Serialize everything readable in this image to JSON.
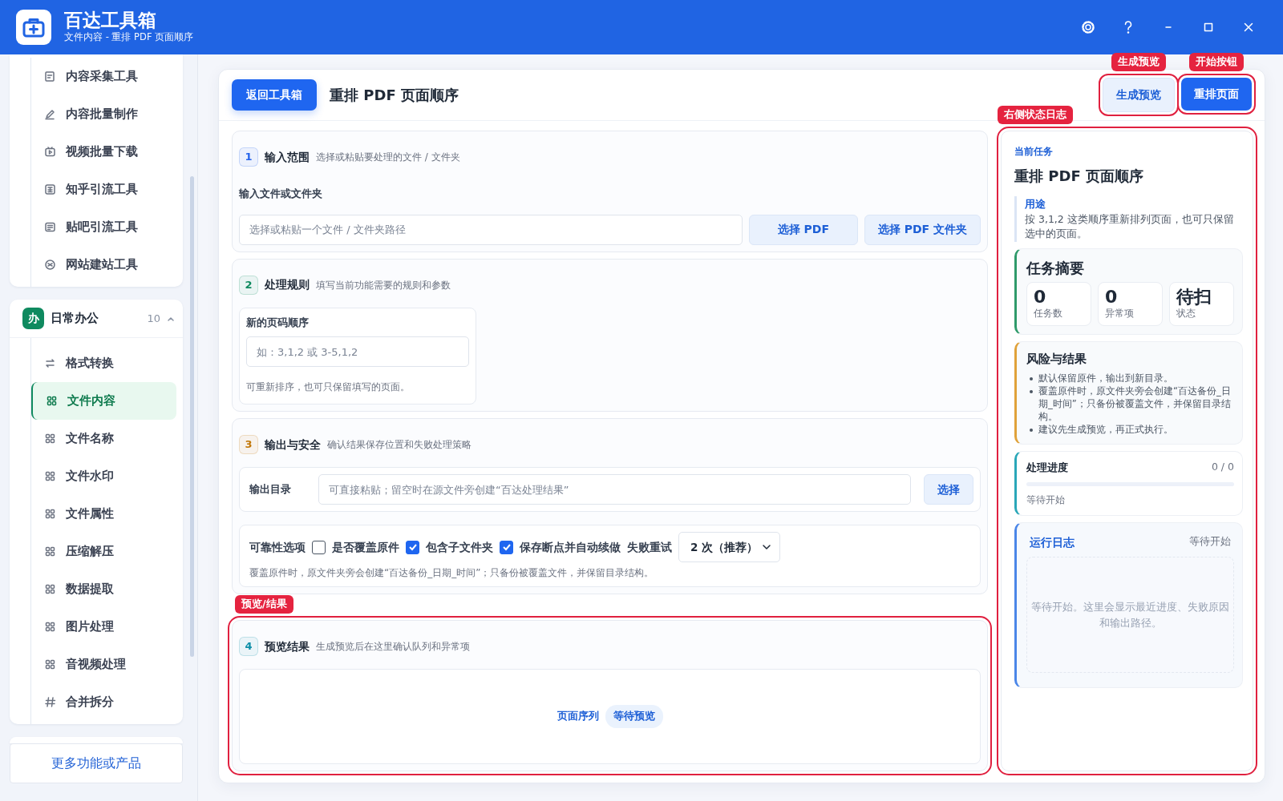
{
  "app": {
    "title": "百达工具箱",
    "subtitle": "文件内容 - 重排 PDF 页面顺序"
  },
  "sidebar": {
    "groups": [
      {
        "items": [
          {
            "label": "内容采集工具",
            "selected": false
          },
          {
            "label": "内容批量制作",
            "selected": false
          },
          {
            "label": "视频批量下载",
            "selected": false
          },
          {
            "label": "知乎引流工具",
            "selected": false
          },
          {
            "label": "贴吧引流工具",
            "selected": false
          },
          {
            "label": "网站建站工具",
            "selected": false
          }
        ]
      },
      {
        "badge": "办",
        "title": "日常办公",
        "count": "10",
        "expanded": true,
        "items": [
          {
            "label": "格式转换",
            "selected": false
          },
          {
            "label": "文件内容",
            "selected": true
          },
          {
            "label": "文件名称",
            "selected": false
          },
          {
            "label": "文件水印",
            "selected": false
          },
          {
            "label": "文件属性",
            "selected": false
          },
          {
            "label": "压缩解压",
            "selected": false
          },
          {
            "label": "数据提取",
            "selected": false
          },
          {
            "label": "图片处理",
            "selected": false
          },
          {
            "label": "音视频处理",
            "selected": false
          },
          {
            "label": "合并拆分",
            "selected": false
          }
        ]
      }
    ],
    "more_button": "更多功能或产品"
  },
  "toolbar": {
    "back_button": "返回工具箱",
    "title": "重排 PDF 页面顺序",
    "preview_annotation": "生成预览",
    "preview_button": "生成预览",
    "start_annotation": "开始按钮",
    "start_button": "重排页面"
  },
  "sections": [
    {
      "kind": "input",
      "number": "1",
      "color": "#2563eb",
      "title": "输入范围",
      "hint": "选择或粘贴要处理的文件 / 文件夹",
      "field_label": "输入文件或文件夹",
      "placeholder": "选择或粘贴一个文件 / 文件夹路径",
      "buttons": [
        "选择 PDF",
        "选择 PDF 文件夹"
      ]
    },
    {
      "kind": "rules",
      "number": "2",
      "color": "#0f8a5f",
      "title": "处理规则",
      "hint": "填写当前功能需要的规则和参数",
      "field_label": "新的页码顺序",
      "placeholder": "如：3,1,2 或 3-5,1,2",
      "help": "可重新排序，也可只保留填写的页面。"
    },
    {
      "kind": "output",
      "number": "3",
      "color": "#c2780a",
      "title": "输出与安全",
      "hint": "确认结果保存位置和失败处理策略",
      "dir_label": "输出目录",
      "dir_placeholder": "可直接粘贴；留空时在源文件旁创建“百达处理结果”",
      "dir_button": "选择",
      "options_label": "可靠性选项",
      "checks": [
        {
          "label": "是否覆盖原件",
          "checked": false
        },
        {
          "label": "包含子文件夹",
          "checked": true
        },
        {
          "label": "保存断点并自动续做",
          "checked": true
        }
      ],
      "retry_label": "失败重试",
      "retry_value": "2 次（推荐）",
      "note": "覆盖原件时，原文件夹旁会创建“百达备份_日期_时间”；只备份被覆盖文件，并保留目录结构。"
    },
    {
      "kind": "preview",
      "annotation": "预览/结果",
      "number": "4",
      "color": "#0e8fa8",
      "title": "预览结果",
      "hint": "生成预览后在这里确认队列和异常项",
      "preview_label": "页面序列",
      "preview_status": "等待预览"
    }
  ],
  "status_panel": {
    "annotation": "右侧状态日志",
    "task_label": "当前任务",
    "task_title": "重排 PDF 页面顺序",
    "purpose_label": "用途",
    "purpose": "按 3,1,2 这类顺序重新排列页面，也可只保留选中的页面。",
    "summary": {
      "title": "任务摘要",
      "stats": [
        {
          "value": "0",
          "label": "任务数"
        },
        {
          "value": "0",
          "label": "异常项"
        },
        {
          "value": "待扫",
          "label": "状态"
        }
      ]
    },
    "risks": {
      "title": "风险与结果",
      "items": [
        "默认保留原件，输出到新目录。",
        "覆盖原件时，原文件夹旁会创建“百达备份_日期_时间”；只备份被覆盖文件，并保留目录结构。",
        "建议先生成预览，再正式执行。"
      ]
    },
    "progress": {
      "title": "处理进度",
      "count": "0 / 0",
      "level": 0,
      "status": "等待开始"
    },
    "log": {
      "title": "运行日志",
      "status": "等待开始",
      "empty": "等待开始。这里会显示最近进度、失败原因和输出路径。"
    }
  }
}
